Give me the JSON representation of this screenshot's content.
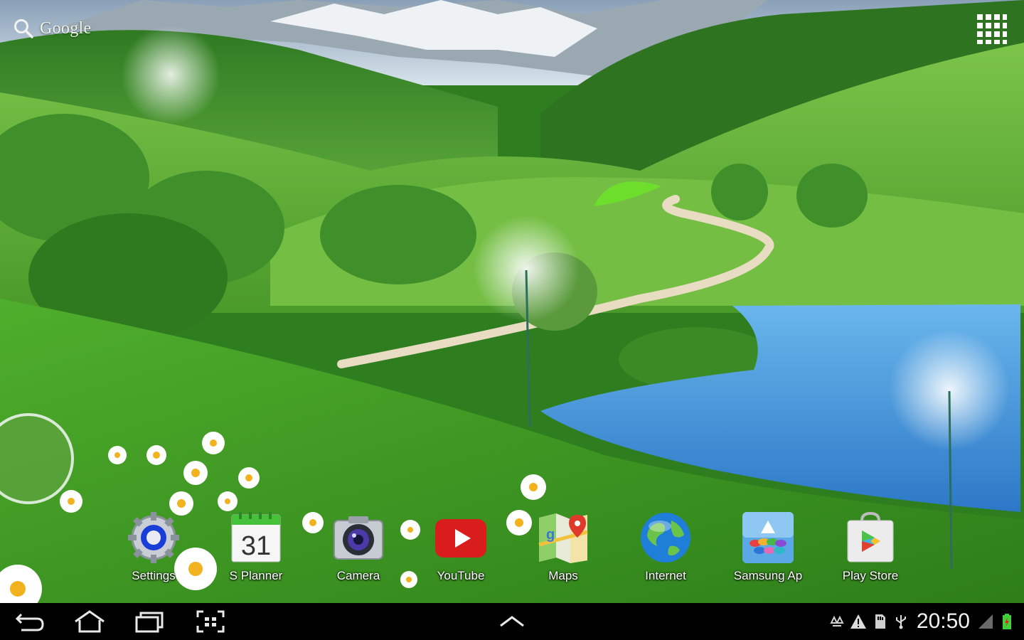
{
  "search": {
    "label": "Google",
    "icon": "search-icon"
  },
  "apps_button": {
    "icon": "apps-grid-icon"
  },
  "dock": [
    {
      "label": "Settings",
      "icon": "settings-icon"
    },
    {
      "label": "S Planner",
      "icon": "calendar-icon",
      "day": "31"
    },
    {
      "label": "Camera",
      "icon": "camera-icon"
    },
    {
      "label": "YouTube",
      "icon": "youtube-icon"
    },
    {
      "label": "Maps",
      "icon": "maps-icon"
    },
    {
      "label": "Internet",
      "icon": "globe-icon"
    },
    {
      "label": "Samsung Ap",
      "icon": "samsung-apps-icon"
    },
    {
      "label": "Play Store",
      "icon": "play-store-icon"
    }
  ],
  "navbar": {
    "buttons": [
      "back-icon",
      "home-icon",
      "recent-apps-icon",
      "screenshot-icon",
      "chevron-up-icon"
    ],
    "time": "20:50"
  },
  "colors": {
    "accent_green": "#3fa52a",
    "lake_blue": "#3a8fd8",
    "navbar": "#000000"
  }
}
